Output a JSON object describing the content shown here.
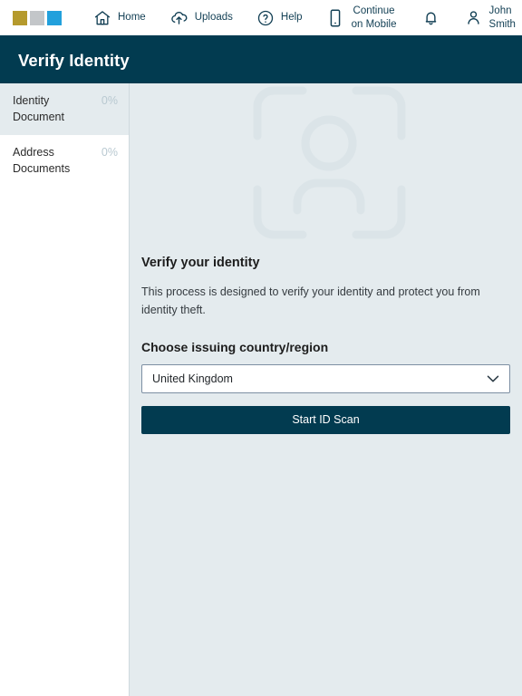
{
  "topnav": {
    "logo": {
      "name": "brand-logo",
      "colors": [
        "#b59a2d",
        "#c3c6c9",
        "#22a0dc"
      ]
    },
    "items": [
      {
        "label": "Home",
        "icon": "home-icon",
        "name": "nav-home"
      },
      {
        "label": "Uploads",
        "icon": "cloud-upload-icon",
        "name": "nav-uploads"
      },
      {
        "label": "Help",
        "icon": "question-circle-icon",
        "name": "nav-help"
      },
      {
        "label": "Continue on Mobile",
        "icon": "mobile-phone-icon",
        "name": "nav-continue-on-mobile"
      }
    ],
    "notifications": {
      "icon": "bell-icon",
      "name": "nav-notifications"
    },
    "user": {
      "label": "John Smith",
      "icon": "person-icon",
      "name": "nav-user-menu"
    }
  },
  "header": {
    "title": "Verify Identity",
    "background": "#023b50"
  },
  "sidebar": {
    "items": [
      {
        "label": "Identity Document",
        "progress": "0%",
        "active": true
      },
      {
        "label": "Address Documents",
        "progress": "0%",
        "active": false
      }
    ]
  },
  "main": {
    "watermark_icon": "face-scan-watermark-icon",
    "heading": "Verify your identity",
    "description": "This process is designed to verify your identity and protect you from identity theft.",
    "field_label": "Choose issuing country/region",
    "country_select": {
      "value": "United Kingdom",
      "icon": "chevron-down-icon"
    },
    "primary_button": {
      "label": "Start ID Scan",
      "color": "#023b50"
    }
  }
}
